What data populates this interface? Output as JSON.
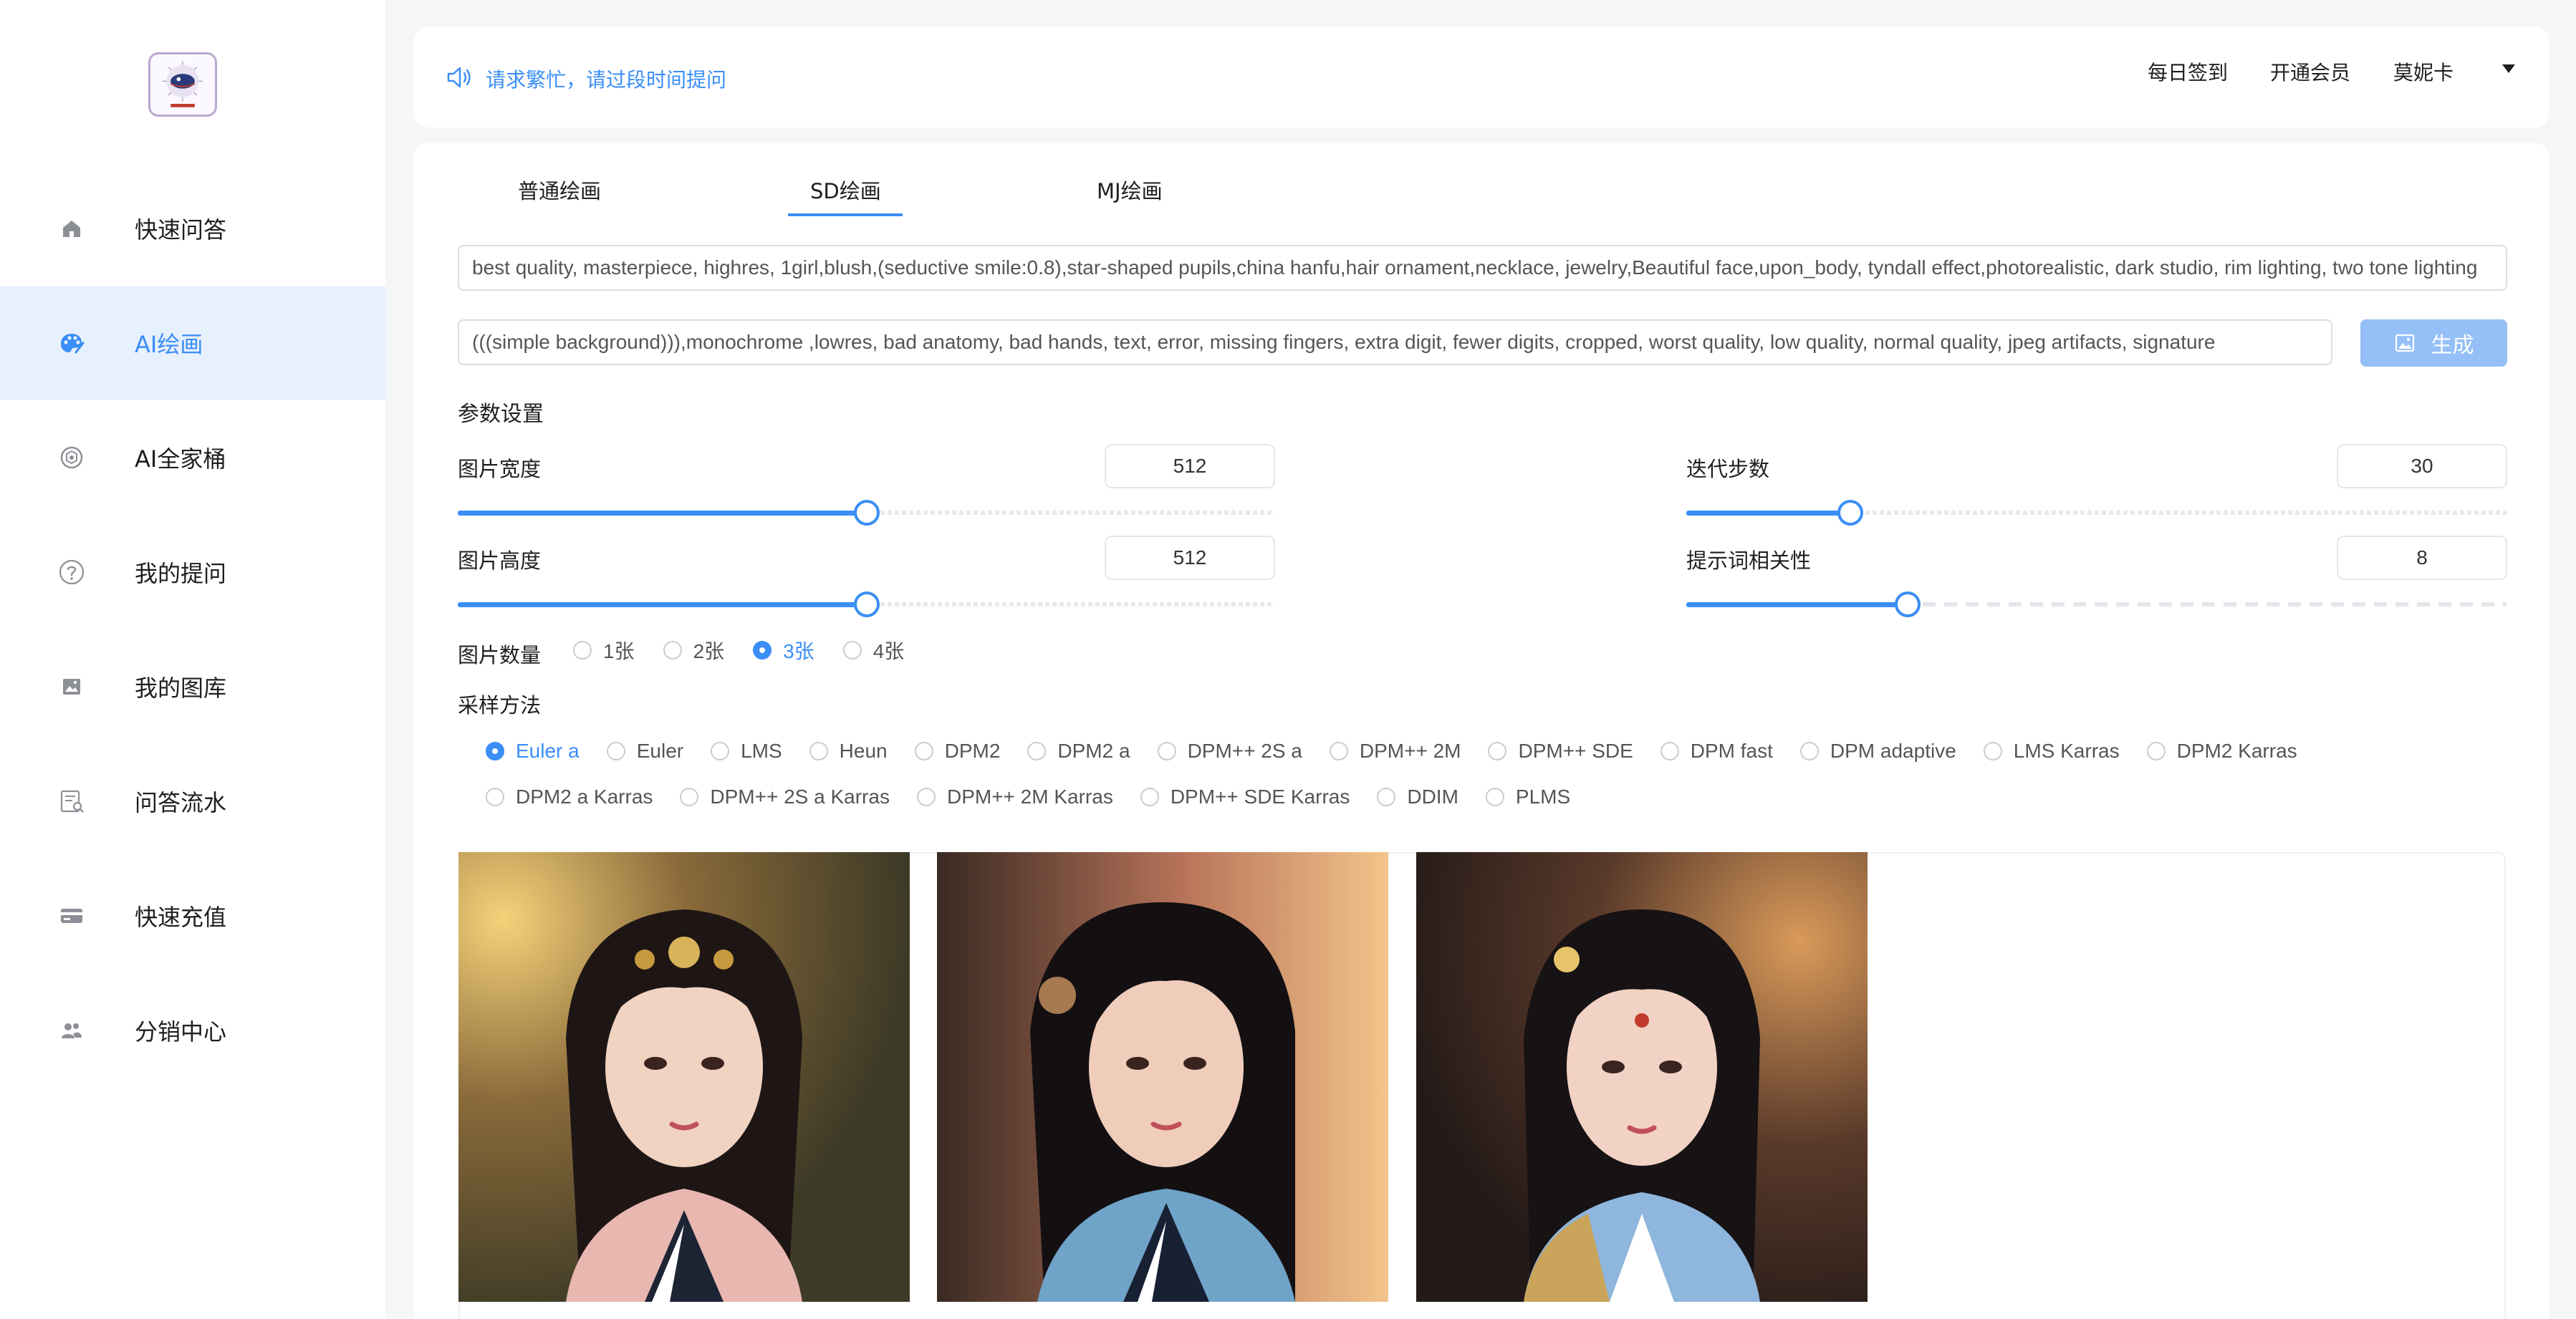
{
  "sidebar": {
    "logo_name": "app-logo",
    "items": [
      {
        "label": "快速问答",
        "icon": "home-icon",
        "active": false
      },
      {
        "label": "AI绘画",
        "icon": "palette-icon",
        "active": true
      },
      {
        "label": "AI全家桶",
        "icon": "openai-icon",
        "active": false
      },
      {
        "label": "我的提问",
        "icon": "question-icon",
        "active": false
      },
      {
        "label": "我的图库",
        "icon": "image-icon",
        "active": false
      },
      {
        "label": "问答流水",
        "icon": "receipt-search-icon",
        "active": false
      },
      {
        "label": "快速充值",
        "icon": "card-icon",
        "active": false
      },
      {
        "label": "分销中心",
        "icon": "users-icon",
        "active": false
      }
    ]
  },
  "notice": {
    "text": "请求繁忙，请过段时间提问",
    "icon": "speaker-icon"
  },
  "header": {
    "checkin": "每日签到",
    "vip": "开通会员",
    "username": "莫妮卡"
  },
  "tabs": [
    {
      "label": "普通绘画",
      "active": false
    },
    {
      "label": "SD绘画",
      "active": true
    },
    {
      "label": "MJ绘画",
      "active": false
    }
  ],
  "prompt": {
    "positive": "best quality, masterpiece, highres, 1girl,blush,(seductive smile:0.8),star-shaped pupils,china hanfu,hair ornament,necklace, jewelry,Beautiful face,upon_body, tyndall effect,photorealistic, dark studio, rim lighting, two tone lighting",
    "negative": "(((simple background))),monochrome ,lowres, bad anatomy, bad hands, text, error, missing fingers, extra digit, fewer digits, cropped, worst quality, low quality, normal quality, jpeg artifacts, signature"
  },
  "generate_button": "生成",
  "params": {
    "section_title": "参数设置",
    "width": {
      "label": "图片宽度",
      "value": "512",
      "fraction": 0.5
    },
    "height": {
      "label": "图片高度",
      "value": "512",
      "fraction": 0.5
    },
    "steps": {
      "label": "迭代步数",
      "value": "30",
      "fraction": 0.2
    },
    "cfg": {
      "label": "提示词相关性",
      "value": "8",
      "fraction": 0.27
    },
    "count": {
      "label": "图片数量",
      "options": [
        "1张",
        "2张",
        "3张",
        "4张"
      ],
      "selected": "3张"
    },
    "sampler": {
      "label": "采样方法",
      "row1": [
        "Euler a",
        "Euler",
        "LMS",
        "Heun",
        "DPM2",
        "DPM2 a",
        "DPM++ 2S a",
        "DPM++ 2M",
        "DPM++ SDE",
        "DPM fast",
        "DPM adaptive",
        "LMS Karras",
        "DPM2 Karras"
      ],
      "row2": [
        "DPM2 a Karras",
        "DPM++ 2S a Karras",
        "DPM++ 2M Karras",
        "DPM++ SDE Karras",
        "DDIM",
        "PLMS"
      ],
      "selected": "Euler a"
    }
  },
  "colors": {
    "accent": "#3a8ef6",
    "active_bg": "#e7f0fd",
    "button_bg": "#94bff7"
  }
}
